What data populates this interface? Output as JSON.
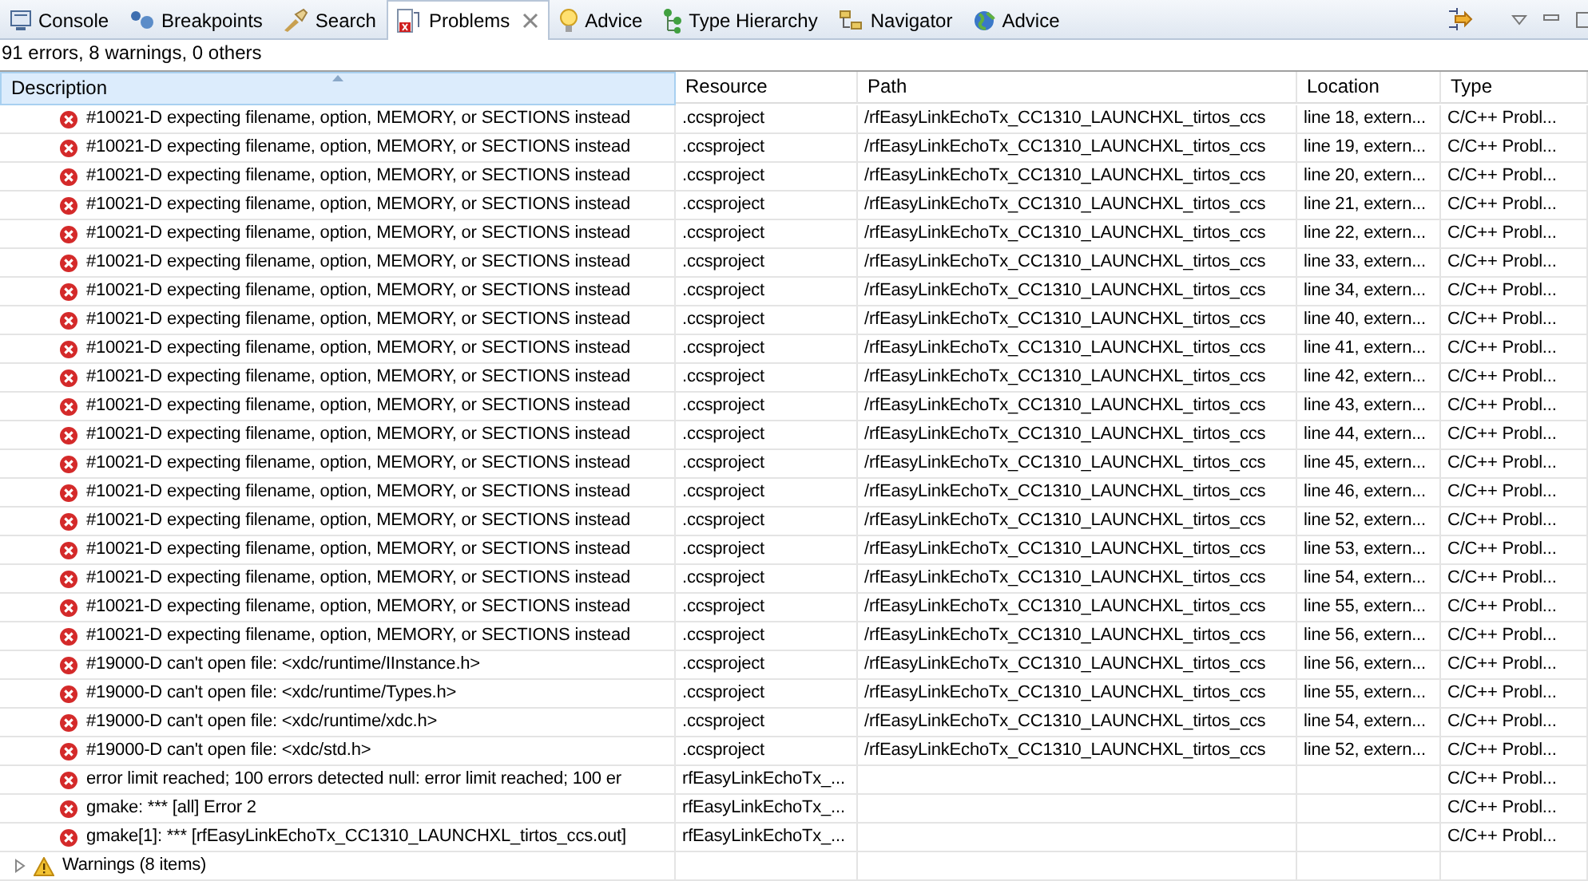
{
  "tabs": [
    {
      "label": "Console",
      "kind": "console",
      "selected": false,
      "closable": false
    },
    {
      "label": "Breakpoints",
      "kind": "breakpoints",
      "selected": false,
      "closable": false
    },
    {
      "label": "Search",
      "kind": "search",
      "selected": false,
      "closable": false
    },
    {
      "label": "Problems",
      "kind": "problems",
      "selected": true,
      "closable": true
    },
    {
      "label": "Advice",
      "kind": "advice",
      "selected": false,
      "closable": false
    },
    {
      "label": "Type Hierarchy",
      "kind": "hierarchy",
      "selected": false,
      "closable": false
    },
    {
      "label": "Navigator",
      "kind": "navigator",
      "selected": false,
      "closable": false
    },
    {
      "label": "Advice",
      "kind": "globe",
      "selected": false,
      "closable": false
    }
  ],
  "summary": "91 errors, 8 warnings, 0 others",
  "table": {
    "columns": [
      {
        "label": "Description",
        "sorted": true
      },
      {
        "label": "Resource",
        "sorted": false
      },
      {
        "label": "Path",
        "sorted": false
      },
      {
        "label": "Location",
        "sorted": false
      },
      {
        "label": "Type",
        "sorted": false
      }
    ],
    "rows": [
      {
        "description": "#10021-D expecting filename, option, MEMORY, or SECTIONS instead",
        "resource": ".ccsproject",
        "path": "/rfEasyLinkEchoTx_CC1310_LAUNCHXL_tirtos_ccs",
        "location": "line 18, extern...",
        "type": "C/C++ Probl..."
      },
      {
        "description": "#10021-D expecting filename, option, MEMORY, or SECTIONS instead",
        "resource": ".ccsproject",
        "path": "/rfEasyLinkEchoTx_CC1310_LAUNCHXL_tirtos_ccs",
        "location": "line 19, extern...",
        "type": "C/C++ Probl..."
      },
      {
        "description": "#10021-D expecting filename, option, MEMORY, or SECTIONS instead",
        "resource": ".ccsproject",
        "path": "/rfEasyLinkEchoTx_CC1310_LAUNCHXL_tirtos_ccs",
        "location": "line 20, extern...",
        "type": "C/C++ Probl..."
      },
      {
        "description": "#10021-D expecting filename, option, MEMORY, or SECTIONS instead",
        "resource": ".ccsproject",
        "path": "/rfEasyLinkEchoTx_CC1310_LAUNCHXL_tirtos_ccs",
        "location": "line 21, extern...",
        "type": "C/C++ Probl..."
      },
      {
        "description": "#10021-D expecting filename, option, MEMORY, or SECTIONS instead",
        "resource": ".ccsproject",
        "path": "/rfEasyLinkEchoTx_CC1310_LAUNCHXL_tirtos_ccs",
        "location": "line 22, extern...",
        "type": "C/C++ Probl..."
      },
      {
        "description": "#10021-D expecting filename, option, MEMORY, or SECTIONS instead",
        "resource": ".ccsproject",
        "path": "/rfEasyLinkEchoTx_CC1310_LAUNCHXL_tirtos_ccs",
        "location": "line 33, extern...",
        "type": "C/C++ Probl..."
      },
      {
        "description": "#10021-D expecting filename, option, MEMORY, or SECTIONS instead",
        "resource": ".ccsproject",
        "path": "/rfEasyLinkEchoTx_CC1310_LAUNCHXL_tirtos_ccs",
        "location": "line 34, extern...",
        "type": "C/C++ Probl..."
      },
      {
        "description": "#10021-D expecting filename, option, MEMORY, or SECTIONS instead",
        "resource": ".ccsproject",
        "path": "/rfEasyLinkEchoTx_CC1310_LAUNCHXL_tirtos_ccs",
        "location": "line 40, extern...",
        "type": "C/C++ Probl..."
      },
      {
        "description": "#10021-D expecting filename, option, MEMORY, or SECTIONS instead",
        "resource": ".ccsproject",
        "path": "/rfEasyLinkEchoTx_CC1310_LAUNCHXL_tirtos_ccs",
        "location": "line 41, extern...",
        "type": "C/C++ Probl..."
      },
      {
        "description": "#10021-D expecting filename, option, MEMORY, or SECTIONS instead",
        "resource": ".ccsproject",
        "path": "/rfEasyLinkEchoTx_CC1310_LAUNCHXL_tirtos_ccs",
        "location": "line 42, extern...",
        "type": "C/C++ Probl..."
      },
      {
        "description": "#10021-D expecting filename, option, MEMORY, or SECTIONS instead",
        "resource": ".ccsproject",
        "path": "/rfEasyLinkEchoTx_CC1310_LAUNCHXL_tirtos_ccs",
        "location": "line 43, extern...",
        "type": "C/C++ Probl..."
      },
      {
        "description": "#10021-D expecting filename, option, MEMORY, or SECTIONS instead",
        "resource": ".ccsproject",
        "path": "/rfEasyLinkEchoTx_CC1310_LAUNCHXL_tirtos_ccs",
        "location": "line 44, extern...",
        "type": "C/C++ Probl..."
      },
      {
        "description": "#10021-D expecting filename, option, MEMORY, or SECTIONS instead",
        "resource": ".ccsproject",
        "path": "/rfEasyLinkEchoTx_CC1310_LAUNCHXL_tirtos_ccs",
        "location": "line 45, extern...",
        "type": "C/C++ Probl..."
      },
      {
        "description": "#10021-D expecting filename, option, MEMORY, or SECTIONS instead",
        "resource": ".ccsproject",
        "path": "/rfEasyLinkEchoTx_CC1310_LAUNCHXL_tirtos_ccs",
        "location": "line 46, extern...",
        "type": "C/C++ Probl..."
      },
      {
        "description": "#10021-D expecting filename, option, MEMORY, or SECTIONS instead",
        "resource": ".ccsproject",
        "path": "/rfEasyLinkEchoTx_CC1310_LAUNCHXL_tirtos_ccs",
        "location": "line 52, extern...",
        "type": "C/C++ Probl..."
      },
      {
        "description": "#10021-D expecting filename, option, MEMORY, or SECTIONS instead",
        "resource": ".ccsproject",
        "path": "/rfEasyLinkEchoTx_CC1310_LAUNCHXL_tirtos_ccs",
        "location": "line 53, extern...",
        "type": "C/C++ Probl..."
      },
      {
        "description": "#10021-D expecting filename, option, MEMORY, or SECTIONS instead",
        "resource": ".ccsproject",
        "path": "/rfEasyLinkEchoTx_CC1310_LAUNCHXL_tirtos_ccs",
        "location": "line 54, extern...",
        "type": "C/C++ Probl..."
      },
      {
        "description": "#10021-D expecting filename, option, MEMORY, or SECTIONS instead",
        "resource": ".ccsproject",
        "path": "/rfEasyLinkEchoTx_CC1310_LAUNCHXL_tirtos_ccs",
        "location": "line 55, extern...",
        "type": "C/C++ Probl..."
      },
      {
        "description": "#10021-D expecting filename, option, MEMORY, or SECTIONS instead",
        "resource": ".ccsproject",
        "path": "/rfEasyLinkEchoTx_CC1310_LAUNCHXL_tirtos_ccs",
        "location": "line 56, extern...",
        "type": "C/C++ Probl..."
      },
      {
        "description": "#19000-D can't open file: <xdc/runtime/IInstance.h>",
        "resource": ".ccsproject",
        "path": "/rfEasyLinkEchoTx_CC1310_LAUNCHXL_tirtos_ccs",
        "location": "line 56, extern...",
        "type": "C/C++ Probl..."
      },
      {
        "description": "#19000-D can't open file: <xdc/runtime/Types.h>",
        "resource": ".ccsproject",
        "path": "/rfEasyLinkEchoTx_CC1310_LAUNCHXL_tirtos_ccs",
        "location": "line 55, extern...",
        "type": "C/C++ Probl..."
      },
      {
        "description": "#19000-D can't open file: <xdc/runtime/xdc.h>",
        "resource": ".ccsproject",
        "path": "/rfEasyLinkEchoTx_CC1310_LAUNCHXL_tirtos_ccs",
        "location": "line 54, extern...",
        "type": "C/C++ Probl..."
      },
      {
        "description": "#19000-D can't open file: <xdc/std.h>",
        "resource": ".ccsproject",
        "path": "/rfEasyLinkEchoTx_CC1310_LAUNCHXL_tirtos_ccs",
        "location": "line 52, extern...",
        "type": "C/C++ Probl..."
      },
      {
        "description": "error limit reached; 100 errors detected null: error limit reached; 100 er",
        "resource": "rfEasyLinkEchoTx_...",
        "type": "C/C++ Probl..."
      },
      {
        "description": "gmake: *** [all] Error 2",
        "resource": "rfEasyLinkEchoTx_...",
        "type": "C/C++ Probl..."
      },
      {
        "description": "gmake[1]: *** [rfEasyLinkEchoTx_CC1310_LAUNCHXL_tirtos_ccs.out]",
        "resource": "rfEasyLinkEchoTx_...",
        "type": "C/C++ Probl..."
      }
    ],
    "groups": [
      {
        "label": "Warnings (8 items)",
        "expanded": false
      }
    ]
  }
}
